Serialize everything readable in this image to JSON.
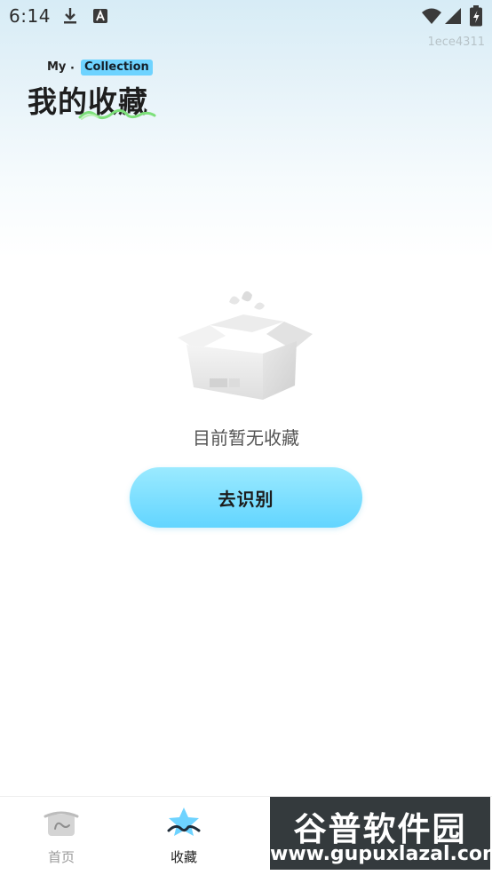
{
  "status_bar": {
    "time": "6:14",
    "icons": [
      "download-icon",
      "a-icon",
      "wifi-icon",
      "signal-icon",
      "battery-icon"
    ]
  },
  "build_id": "1ece4311",
  "header": {
    "my": "My",
    "dot": "·",
    "collection": "Collection",
    "title": "我的收藏"
  },
  "empty_state": {
    "icon": "empty-box-icon",
    "text": "目前暂无收藏",
    "button_label": "去识别"
  },
  "bottom_nav": {
    "items": [
      {
        "label": "首页",
        "icon": "home-icon",
        "active": false
      },
      {
        "label": "收藏",
        "icon": "star-icon",
        "active": true
      }
    ]
  },
  "watermark": {
    "logo": "谷普软件园",
    "url": "www.gupuxlazal.com"
  },
  "colors": {
    "accent": "#6ed3ff",
    "button_top": "#9beaff",
    "button_bottom": "#62d5ff",
    "squiggle": "#7de07a"
  }
}
